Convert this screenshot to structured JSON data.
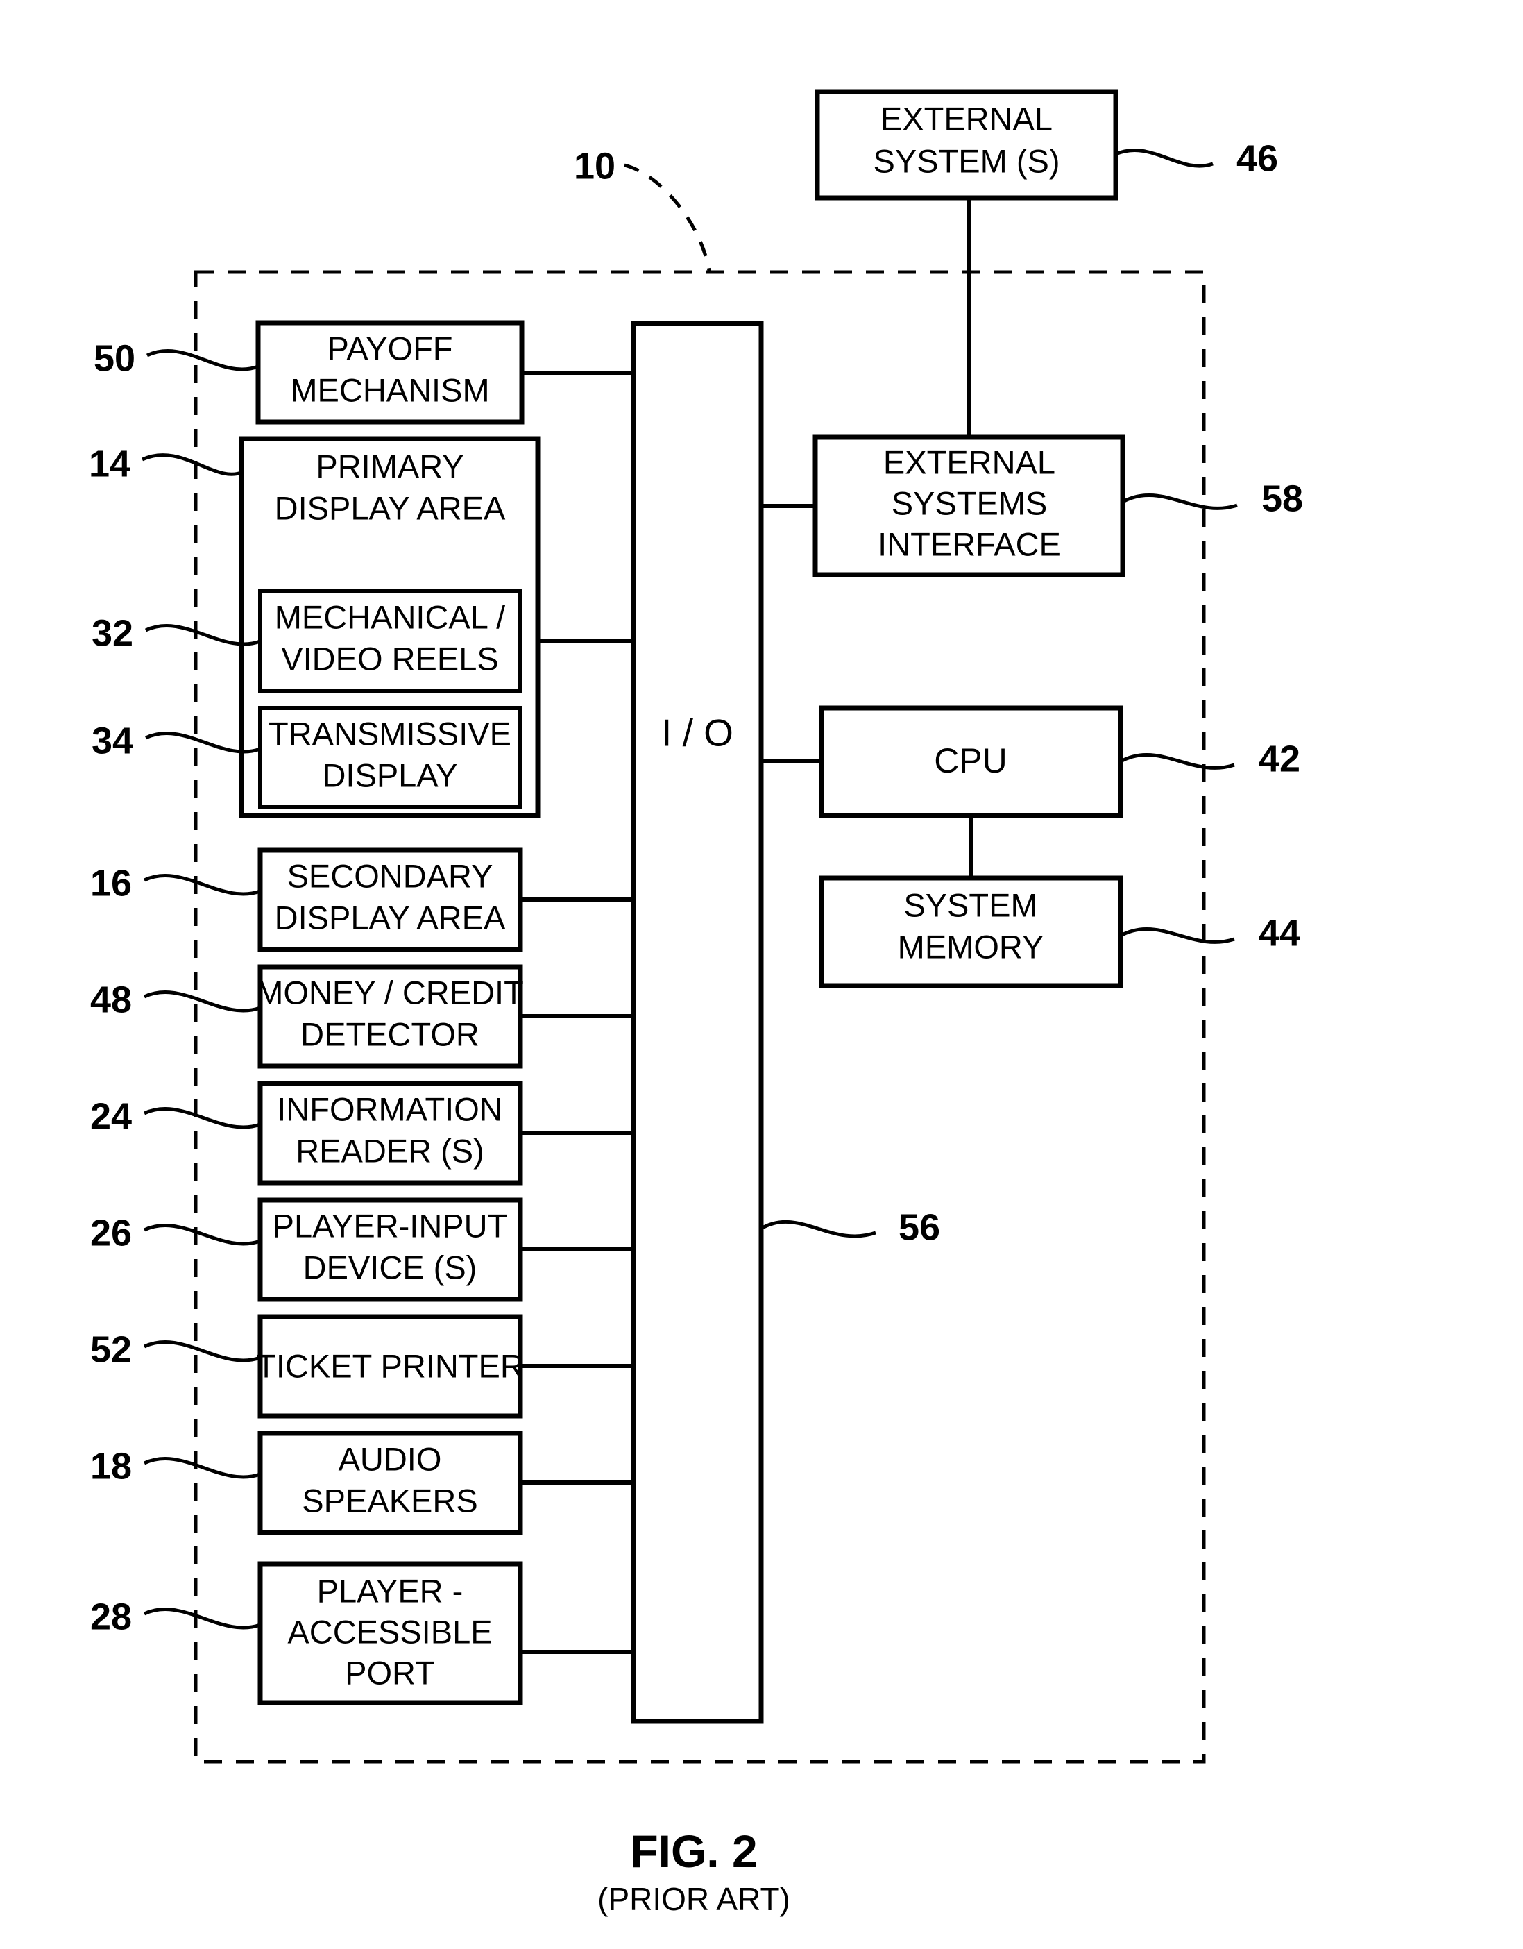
{
  "figure": {
    "title": "FIG. 2",
    "subtitle": "(PRIOR ART)",
    "system_ref": "10"
  },
  "boxes": {
    "external_systems": {
      "lines": [
        "EXTERNAL",
        "SYSTEM (S)"
      ],
      "ref": "46"
    },
    "external_systems_interface": {
      "lines": [
        "EXTERNAL",
        "SYSTEMS",
        "INTERFACE"
      ],
      "ref": "58"
    },
    "cpu": {
      "lines": [
        "CPU"
      ],
      "ref": "42"
    },
    "system_memory": {
      "lines": [
        "SYSTEM",
        "MEMORY"
      ],
      "ref": "44"
    },
    "io": {
      "lines": [
        "I / O"
      ],
      "ref": "56"
    },
    "payoff_mechanism": {
      "lines": [
        "PAYOFF",
        "MECHANISM"
      ],
      "ref": "50"
    },
    "primary_display_area": {
      "lines": [
        "PRIMARY",
        "DISPLAY AREA"
      ],
      "ref": "14"
    },
    "mechanical_video_reels": {
      "lines": [
        "MECHANICAL /",
        "VIDEO REELS"
      ],
      "ref": "32"
    },
    "transmissive_display": {
      "lines": [
        "TRANSMISSIVE",
        "DISPLAY"
      ],
      "ref": "34"
    },
    "secondary_display_area": {
      "lines": [
        "SECONDARY",
        "DISPLAY AREA"
      ],
      "ref": "16"
    },
    "money_credit_detector": {
      "lines": [
        "MONEY / CREDIT",
        "DETECTOR"
      ],
      "ref": "48"
    },
    "information_readers": {
      "lines": [
        "INFORMATION",
        "READER (S)"
      ],
      "ref": "24"
    },
    "player_input_devices": {
      "lines": [
        "PLAYER-INPUT",
        "DEVICE (S)"
      ],
      "ref": "26"
    },
    "ticket_printer": {
      "lines": [
        "TICKET PRINTER"
      ],
      "ref": "52"
    },
    "audio_speakers": {
      "lines": [
        "AUDIO",
        "SPEAKERS"
      ],
      "ref": "18"
    },
    "player_accessible_port": {
      "lines": [
        "PLAYER -",
        "ACCESSIBLE",
        "PORT"
      ],
      "ref": "28"
    }
  },
  "colors": {
    "stroke": "#000000",
    "background": "#ffffff"
  }
}
